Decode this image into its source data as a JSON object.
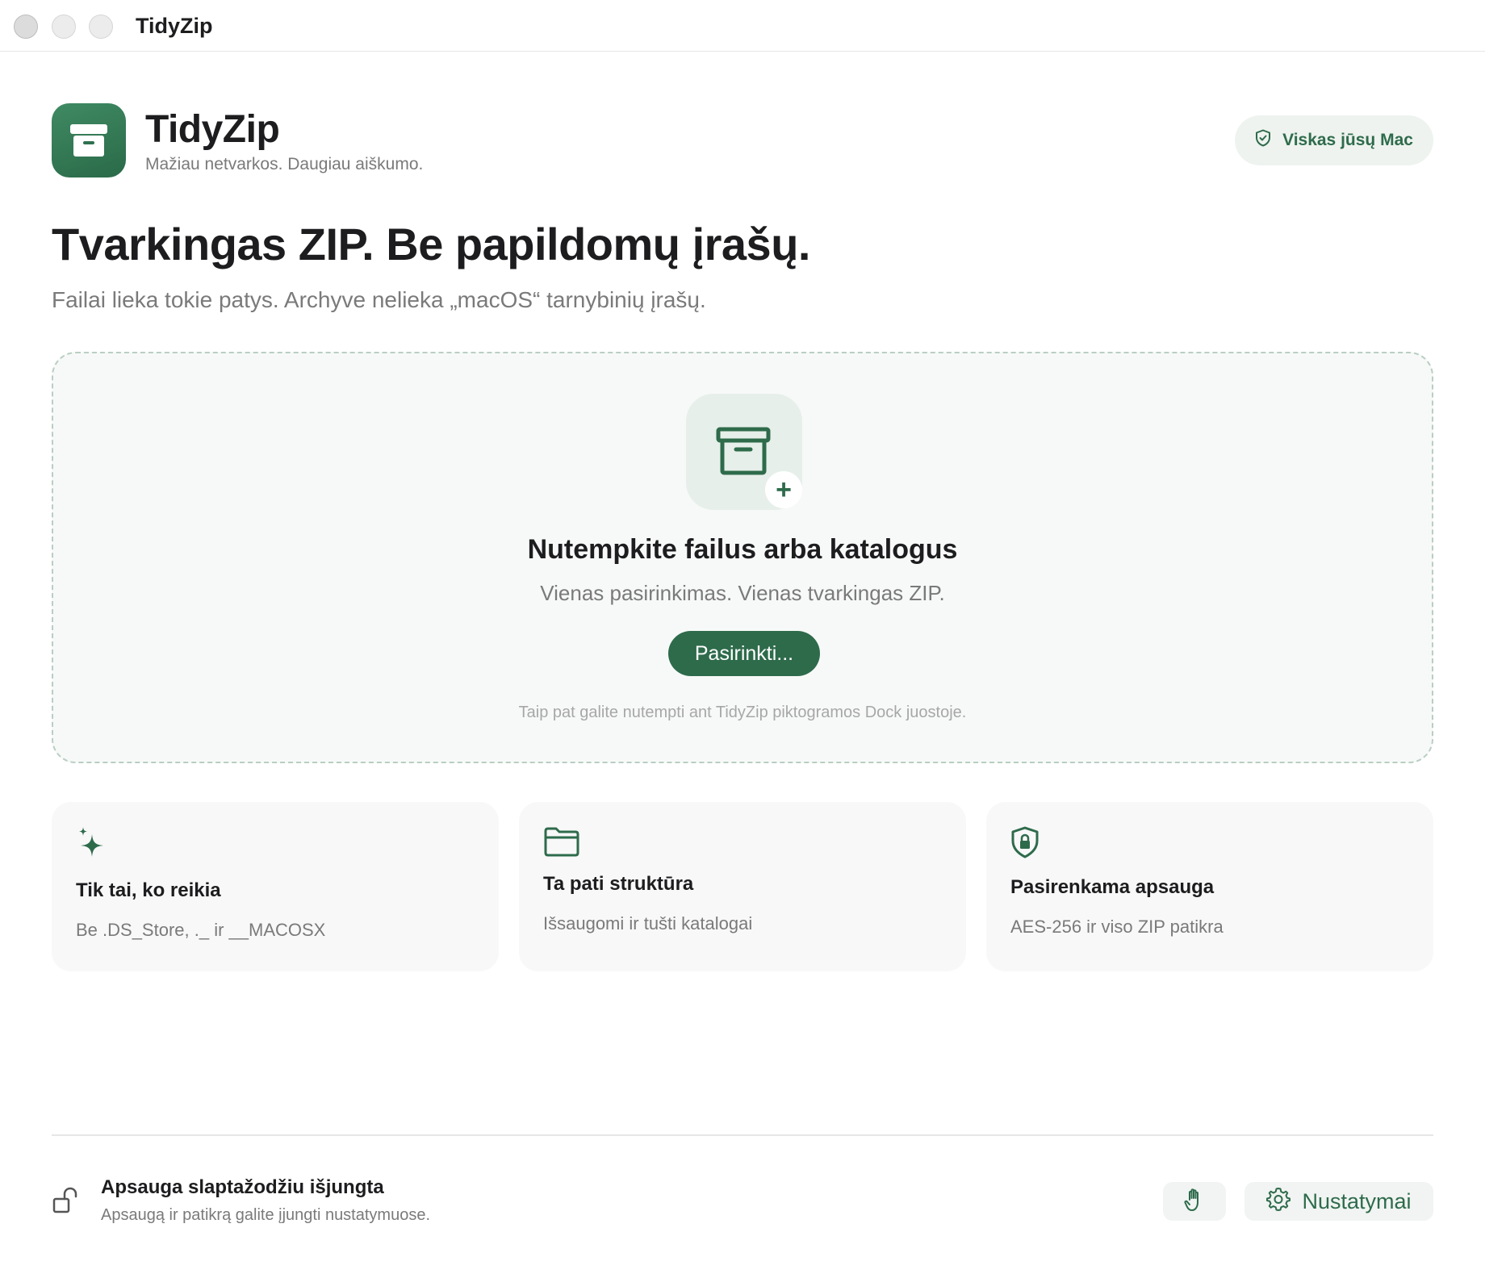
{
  "window": {
    "title": "TidyZip"
  },
  "header": {
    "app_name": "TidyZip",
    "tagline": "Mažiau netvarkos. Daugiau aiškumo.",
    "privacy_badge": "Viskas jūsų Mac"
  },
  "hero": {
    "headline": "Tvarkingas ZIP. Be papildomų įrašų.",
    "subheadline": "Failai lieka tokie patys. Archyve nelieka „macOS“ tarnybinių įrašų."
  },
  "dropzone": {
    "title": "Nutempkite failus arba katalogus",
    "subtitle": "Vienas pasirinkimas. Vienas tvarkingas ZIP.",
    "button_label": "Pasirinkti...",
    "hint": "Taip pat galite nutempti ant TidyZip piktogramos Dock juostoje."
  },
  "features": [
    {
      "icon": "sparkles-icon",
      "title": "Tik tai, ko reikia",
      "description": "Be .DS_Store, ._ ir __MACOSX"
    },
    {
      "icon": "folder-icon",
      "title": "Ta pati struktūra",
      "description": "Išsaugomi ir tušti katalogai"
    },
    {
      "icon": "shield-lock-icon",
      "title": "Pasirenkama apsauga",
      "description": "AES-256 ir viso ZIP patikra"
    }
  ],
  "footer": {
    "status_title": "Apsauga slaptažodžiu išjungta",
    "status_subtitle": "Apsaugą ir patikrą galite įjungti nustatymuose.",
    "settings_label": "Nustatymai"
  },
  "colors": {
    "accent": "#2e6b4b",
    "accent_light": "#eef3ef",
    "text_primary": "#1d1d1f",
    "text_secondary": "#7a7a7a"
  }
}
